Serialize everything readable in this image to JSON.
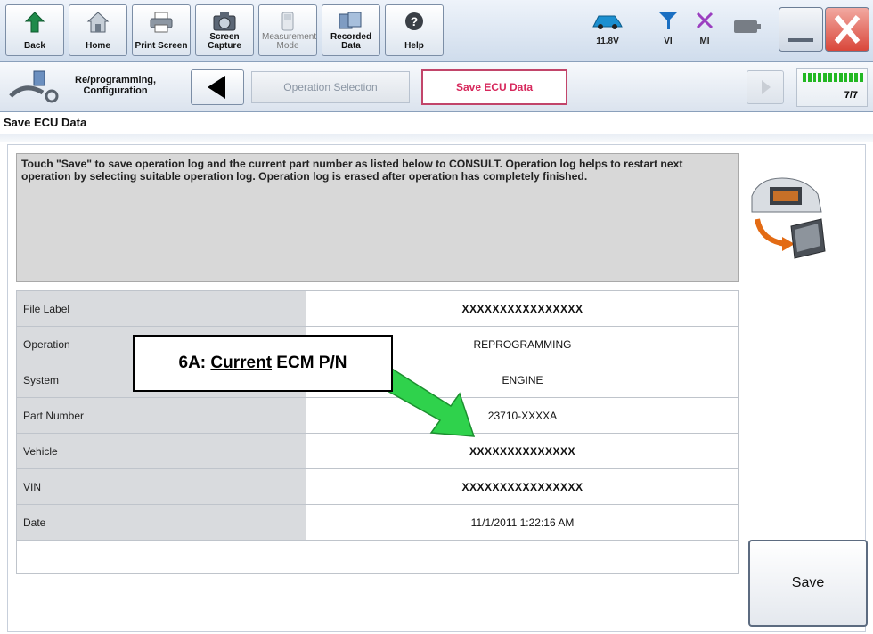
{
  "toolbar": {
    "buttons": [
      {
        "label": "Back",
        "enabled": true
      },
      {
        "label": "Home",
        "enabled": true
      },
      {
        "label": "Print Screen",
        "enabled": true
      },
      {
        "label": "Screen Capture",
        "enabled": true
      },
      {
        "label": "Measurement Mode",
        "enabled": false
      },
      {
        "label": "Recorded Data",
        "enabled": true
      },
      {
        "label": "Help",
        "enabled": true
      }
    ],
    "battery_voltage": "11.8V",
    "vi_label": "VI",
    "mi_label": "MI"
  },
  "nav": {
    "section_title_line1": "Re/programming,",
    "section_title_line2": "Configuration",
    "step_previous": "Operation Selection",
    "step_current": "Save ECU Data",
    "progress_text": "7/7",
    "progress_fraction": 1.0
  },
  "page": {
    "heading": "Save ECU Data",
    "message": "Touch \"Save\" to save operation log and the current part number as listed below to CONSULT. Operation log helps to restart next operation by selecting suitable operation log. Operation log is erased after operation has completely finished."
  },
  "table": {
    "rows": [
      {
        "label": "File Label",
        "value": "XXXXXXXXXXXXXXXX"
      },
      {
        "label": "Operation",
        "value": "REPROGRAMMING"
      },
      {
        "label": "System",
        "value": "ENGINE"
      },
      {
        "label": "Part Number",
        "value": "23710-XXXXA"
      },
      {
        "label": "Vehicle",
        "value": "XXXXXXXXXXXXXX"
      },
      {
        "label": "VIN",
        "value": "XXXXXXXXXXXXXXXX"
      },
      {
        "label": "Date",
        "value": "11/1/2011 1:22:16 AM"
      }
    ]
  },
  "callout": {
    "prefix": "6A: ",
    "emphasis": "Current",
    "suffix": " ECM P/N"
  },
  "save_button": {
    "label": "Save"
  }
}
